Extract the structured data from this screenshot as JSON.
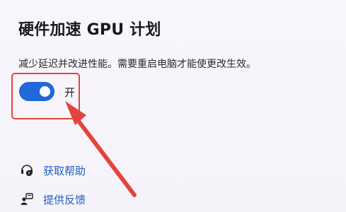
{
  "section": {
    "title": "硬件加速 GPU 计划",
    "description": "减少延迟并改进性能。需要重启电脑才能使更改生效。",
    "toggle": {
      "state": "on",
      "label": "开"
    }
  },
  "links": [
    {
      "label": "获取帮助",
      "icon": "help-headset-icon"
    },
    {
      "label": "提供反馈",
      "icon": "feedback-person-icon"
    }
  ],
  "annotation": {
    "box_color": "#e3443c",
    "arrow_color": "#e3443c"
  },
  "colors": {
    "accent": "#1f6ad8",
    "link": "#1f5fbf"
  }
}
